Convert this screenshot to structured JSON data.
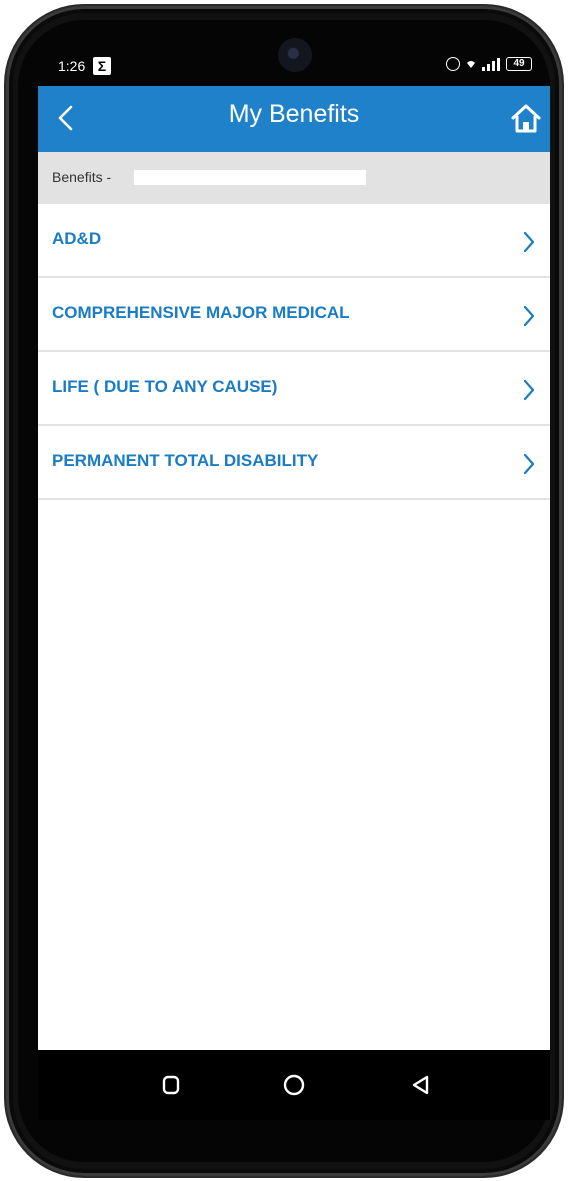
{
  "status_bar": {
    "time": "1:26",
    "notification_icon": "sigma-icon",
    "battery_level": "49",
    "icons": [
      "alarm-icon",
      "wifi-icon",
      "signal-icon",
      "battery-icon"
    ]
  },
  "app_bar": {
    "title": "My Benefits",
    "back_icon": "chevron-left-icon",
    "home_icon": "home-icon",
    "background_color": "#1f81c9"
  },
  "sub_header": {
    "label": "Benefits -"
  },
  "benefits": {
    "items": [
      {
        "label": "AD&D"
      },
      {
        "label": "COMPREHENSIVE MAJOR MEDICAL"
      },
      {
        "label": "LIFE ( DUE TO ANY CAUSE)"
      },
      {
        "label": "PERMANENT TOTAL DISABILITY"
      }
    ],
    "text_color": "#1a7cc4"
  },
  "nav_bar": {
    "buttons": [
      "recents-square-icon",
      "home-circle-icon",
      "back-triangle-icon"
    ]
  }
}
